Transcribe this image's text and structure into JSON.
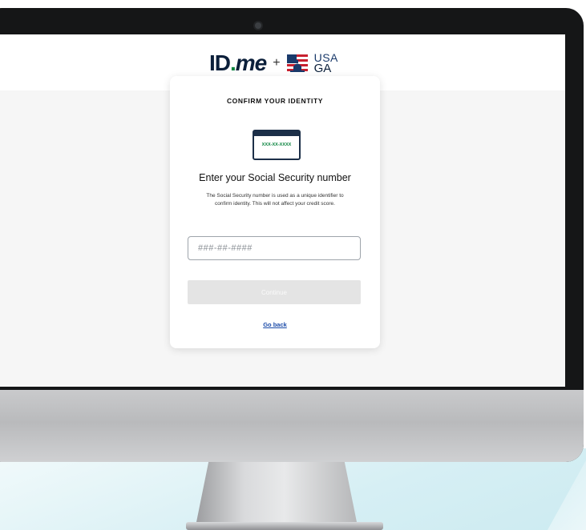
{
  "header": {
    "logo_idme_id": "ID",
    "logo_idme_dot": ".",
    "logo_idme_me": "me",
    "logo_plus": "+",
    "logo_usa": "USA",
    "logo_ga": "GA"
  },
  "card": {
    "title": "CONFIRM YOUR IDENTITY",
    "ssn_icon_text": "XXX-XX-XXXX",
    "heading": "Enter your Social Security number",
    "description": "The Social Security number is used as a unique identifier to confirm identity. This will not affect your credit score.",
    "ssn_placeholder": "###-##-####",
    "ssn_value": "",
    "continue_label": "Continue",
    "go_back_label": "Go back"
  },
  "colors": {
    "brand_navy": "#0b1f3a",
    "brand_green": "#08833d",
    "link_blue": "#1a4aa8",
    "disabled_button": "#e4e4e4"
  },
  "icons": {
    "flag": "us-flag-capitol-icon",
    "ssn_card": "ssn-card-icon"
  }
}
